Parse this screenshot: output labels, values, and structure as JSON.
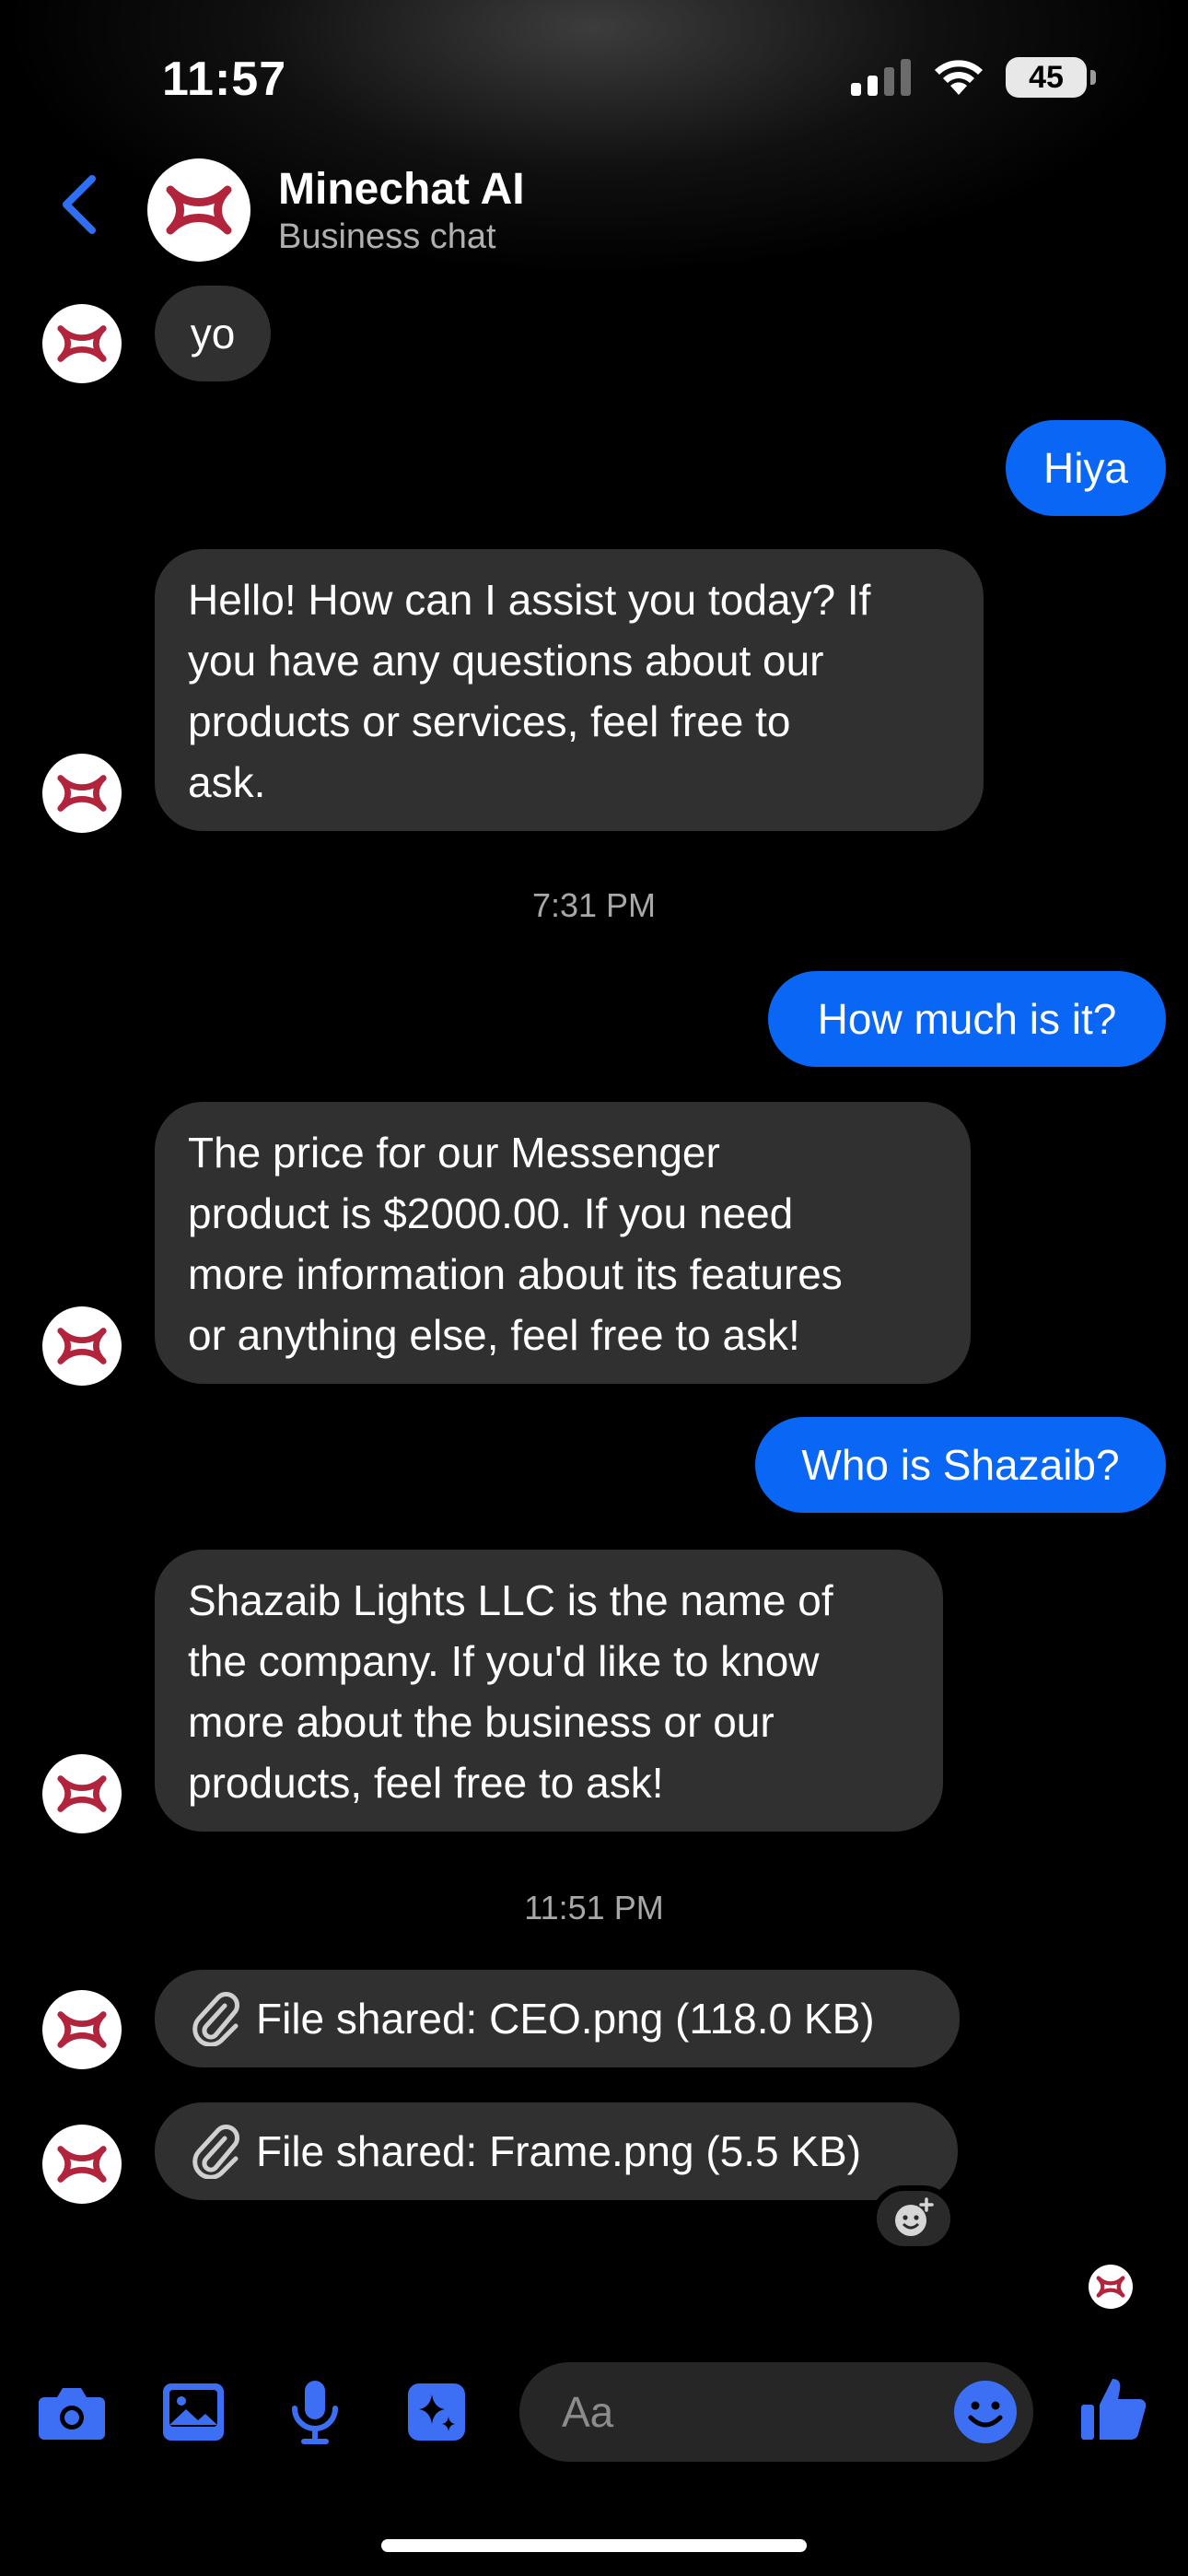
{
  "status": {
    "time": "11:57",
    "battery": "45"
  },
  "header": {
    "title": "Minechat AI",
    "subtitle": "Business chat"
  },
  "messages": [
    {
      "dir": "in",
      "text": "yo"
    },
    {
      "dir": "out",
      "text": "Hiya"
    },
    {
      "dir": "in",
      "lines": [
        "Hello! How can I assist you today? If",
        "you have any questions about our",
        "products or services, feel free to",
        "ask."
      ]
    },
    {
      "dir": "time",
      "text": "7:31 PM"
    },
    {
      "dir": "out",
      "text": "How much is it?"
    },
    {
      "dir": "in",
      "lines": [
        "The price for our Messenger",
        "product is $2000.00. If you need",
        "more information about its features",
        "or anything else, feel free to ask!"
      ]
    },
    {
      "dir": "out",
      "text": "Who is Shazaib?"
    },
    {
      "dir": "in",
      "lines": [
        "Shazaib Lights LLC is the name of",
        "the company. If you'd like to know",
        "more about the business or our",
        "products, feel free to ask!"
      ]
    },
    {
      "dir": "time",
      "text": "11:51 PM"
    },
    {
      "dir": "in",
      "text": "File shared: CEO.png (118.0 KB)"
    },
    {
      "dir": "in",
      "text": "File shared: Frame.png (5.5 KB)"
    }
  ],
  "composer": {
    "placeholder": "Aa"
  },
  "colors": {
    "accent": "#0a66f5",
    "icon_blue": "#3d6ff5",
    "brand_red": "#b1243c"
  }
}
